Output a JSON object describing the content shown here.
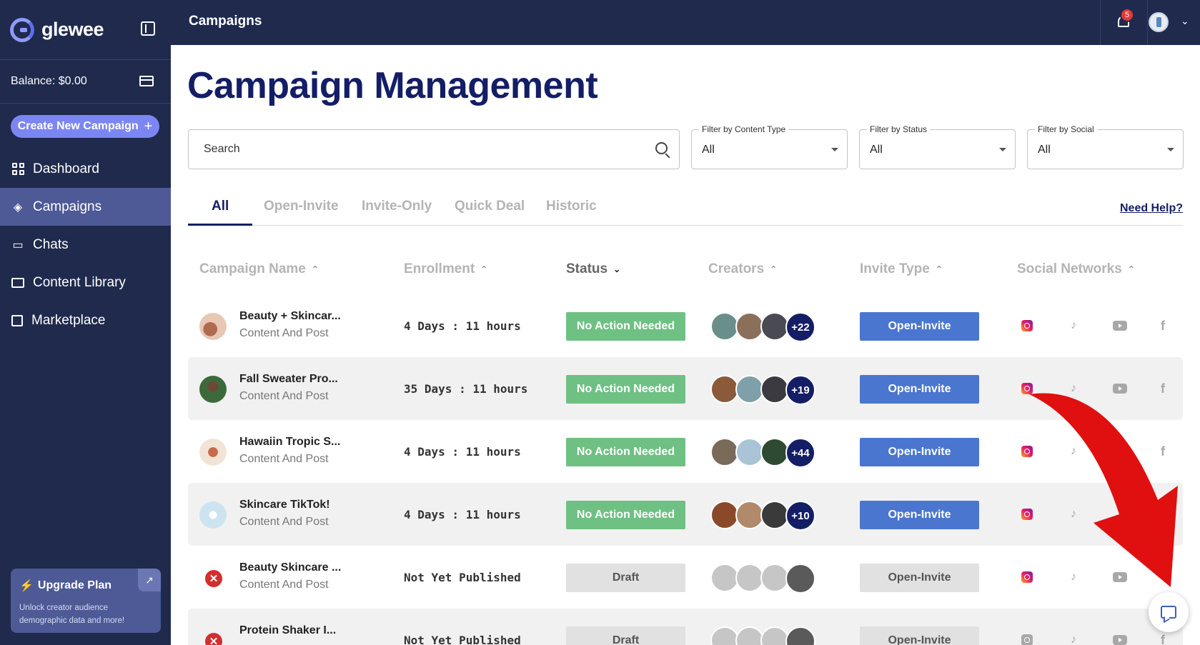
{
  "app": {
    "brand": "glewee",
    "balance": "Balance: $0.00"
  },
  "sidebar": {
    "create_button": "Create New Campaign",
    "items": [
      {
        "label": "Dashboard"
      },
      {
        "label": "Campaigns"
      },
      {
        "label": "Chats"
      },
      {
        "label": "Content Library"
      },
      {
        "label": "Marketplace"
      }
    ],
    "upgrade": {
      "title": "Upgrade Plan",
      "subtitle": "Unlock creator audience demographic data and more!"
    }
  },
  "header": {
    "title": "Campaigns",
    "notifications": "5"
  },
  "main": {
    "title": "Campaign Management",
    "search": {
      "placeholder": "Search"
    },
    "filters": [
      {
        "label": "Filter by Content Type",
        "value": "All"
      },
      {
        "label": "Filter by Status",
        "value": "All"
      },
      {
        "label": "Filter by Social",
        "value": "All"
      }
    ],
    "tabs": [
      "All",
      "Open-Invite",
      "Invite-Only",
      "Quick Deal",
      "Historic"
    ],
    "help_link": "Need Help?",
    "columns": [
      "Campaign Name",
      "Enrollment",
      "Status",
      "Creators",
      "Invite Type",
      "Social Networks"
    ],
    "rows": [
      {
        "name": "Beauty + Skincar...",
        "type": "Content And Post",
        "enrollment": "4 Days : 11 hours",
        "status": "No Action Needed",
        "creators_more": "+22",
        "invite": "Open-Invite"
      },
      {
        "name": "Fall Sweater Pro...",
        "type": "Content And Post",
        "enrollment": "35 Days : 11 hours",
        "status": "No Action Needed",
        "creators_more": "+19",
        "invite": "Open-Invite"
      },
      {
        "name": "Hawaiin Tropic S...",
        "type": "Content And Post",
        "enrollment": "4 Days : 11 hours",
        "status": "No Action Needed",
        "creators_more": "+44",
        "invite": "Open-Invite"
      },
      {
        "name": "Skincare TikTok!",
        "type": "Content And Post",
        "enrollment": "4 Days : 11 hours",
        "status": "No Action Needed",
        "creators_more": "+10",
        "invite": "Open-Invite"
      },
      {
        "name": "Beauty Skincare ...",
        "type": "Content And Post",
        "enrollment": "Not Yet Published",
        "status": "Draft",
        "creators_more": "",
        "invite": "Open-Invite"
      },
      {
        "name": "Protein Shaker I...",
        "type": "",
        "enrollment": "Not Yet Published",
        "status": "Draft",
        "creators_more": "",
        "invite": "Open-Invite"
      }
    ]
  },
  "icons": {
    "social": [
      "instagram-icon",
      "tiktok-icon",
      "youtube-icon",
      "facebook-icon"
    ],
    "tiktok_glyph": "♪",
    "facebook_glyph": "f",
    "error_glyph": "✕",
    "plus_glyph": "+",
    "bolt_glyph": "⚡",
    "arrow_glyph": "↗",
    "sort_up": "⌃",
    "sort_down": "⌄"
  },
  "colors": {
    "navy": "#1f2a4d",
    "title": "#141e66",
    "accent": "#7c86f2",
    "green": "#6fc083",
    "blue": "#4a76d0",
    "annotation_arrow": "#e01010"
  }
}
